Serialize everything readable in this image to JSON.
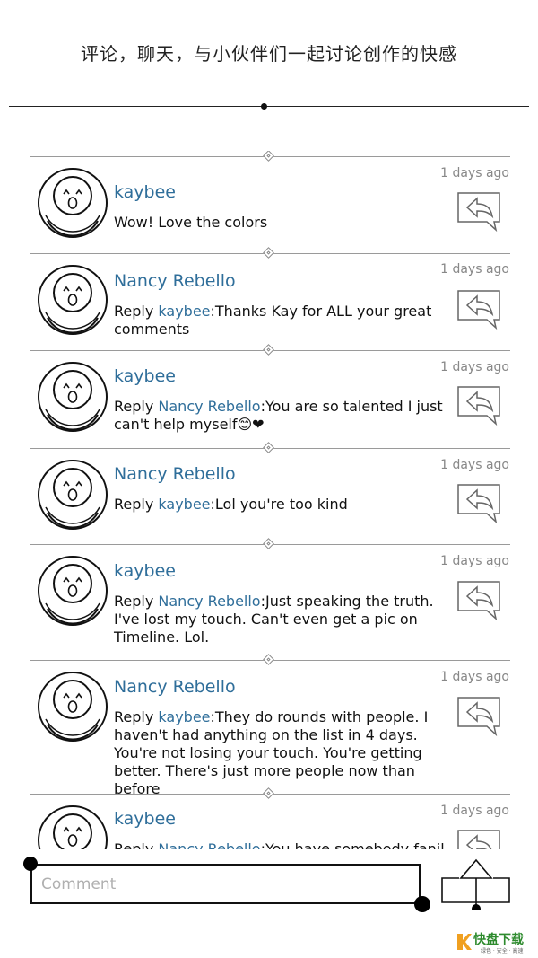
{
  "header": {
    "title": "评论，聊天，与小伙伴们一起讨论创作的快感"
  },
  "comments": [
    {
      "name": "kaybee",
      "reply_prefix": "",
      "mention": "",
      "text": "Wow! Love the colors",
      "time": "1 days ago"
    },
    {
      "name": "Nancy Rebello",
      "reply_prefix": "Reply ",
      "mention": "kaybee",
      "text": ":Thanks Kay for ALL your great comments",
      "time": "1 days ago"
    },
    {
      "name": "kaybee",
      "reply_prefix": "Reply ",
      "mention": "Nancy Rebello",
      "text": ":You are so talented I just can't help myself😊❤",
      "time": "1 days ago"
    },
    {
      "name": "Nancy Rebello",
      "reply_prefix": "Reply ",
      "mention": "kaybee",
      "text": ":Lol you're too kind",
      "time": "1 days ago"
    },
    {
      "name": "kaybee",
      "reply_prefix": "Reply ",
      "mention": "Nancy Rebello",
      "text": ":Just speaking the truth. I've lost my touch. Can't even get a pic on Timeline. Lol.",
      "time": "1 days ago"
    },
    {
      "name": "Nancy Rebello",
      "reply_prefix": "Reply ",
      "mention": "kaybee",
      "text": ":They do rounds with people. I haven't had anything on the list in 4 days. You're not losing your touch. You're getting better. There's just more people now than before",
      "time": "1 days ago"
    },
    {
      "name": "kaybee",
      "reply_prefix": "Reply ",
      "mention": "Nancy Rebello",
      "text": ":You have somebody fanil",
      "time": "1 days ago"
    }
  ],
  "comment_bar": {
    "placeholder": "Comment"
  },
  "watermark": {
    "brand": "快盘下载",
    "tagline": "绿色 · 安全 · 高速"
  }
}
